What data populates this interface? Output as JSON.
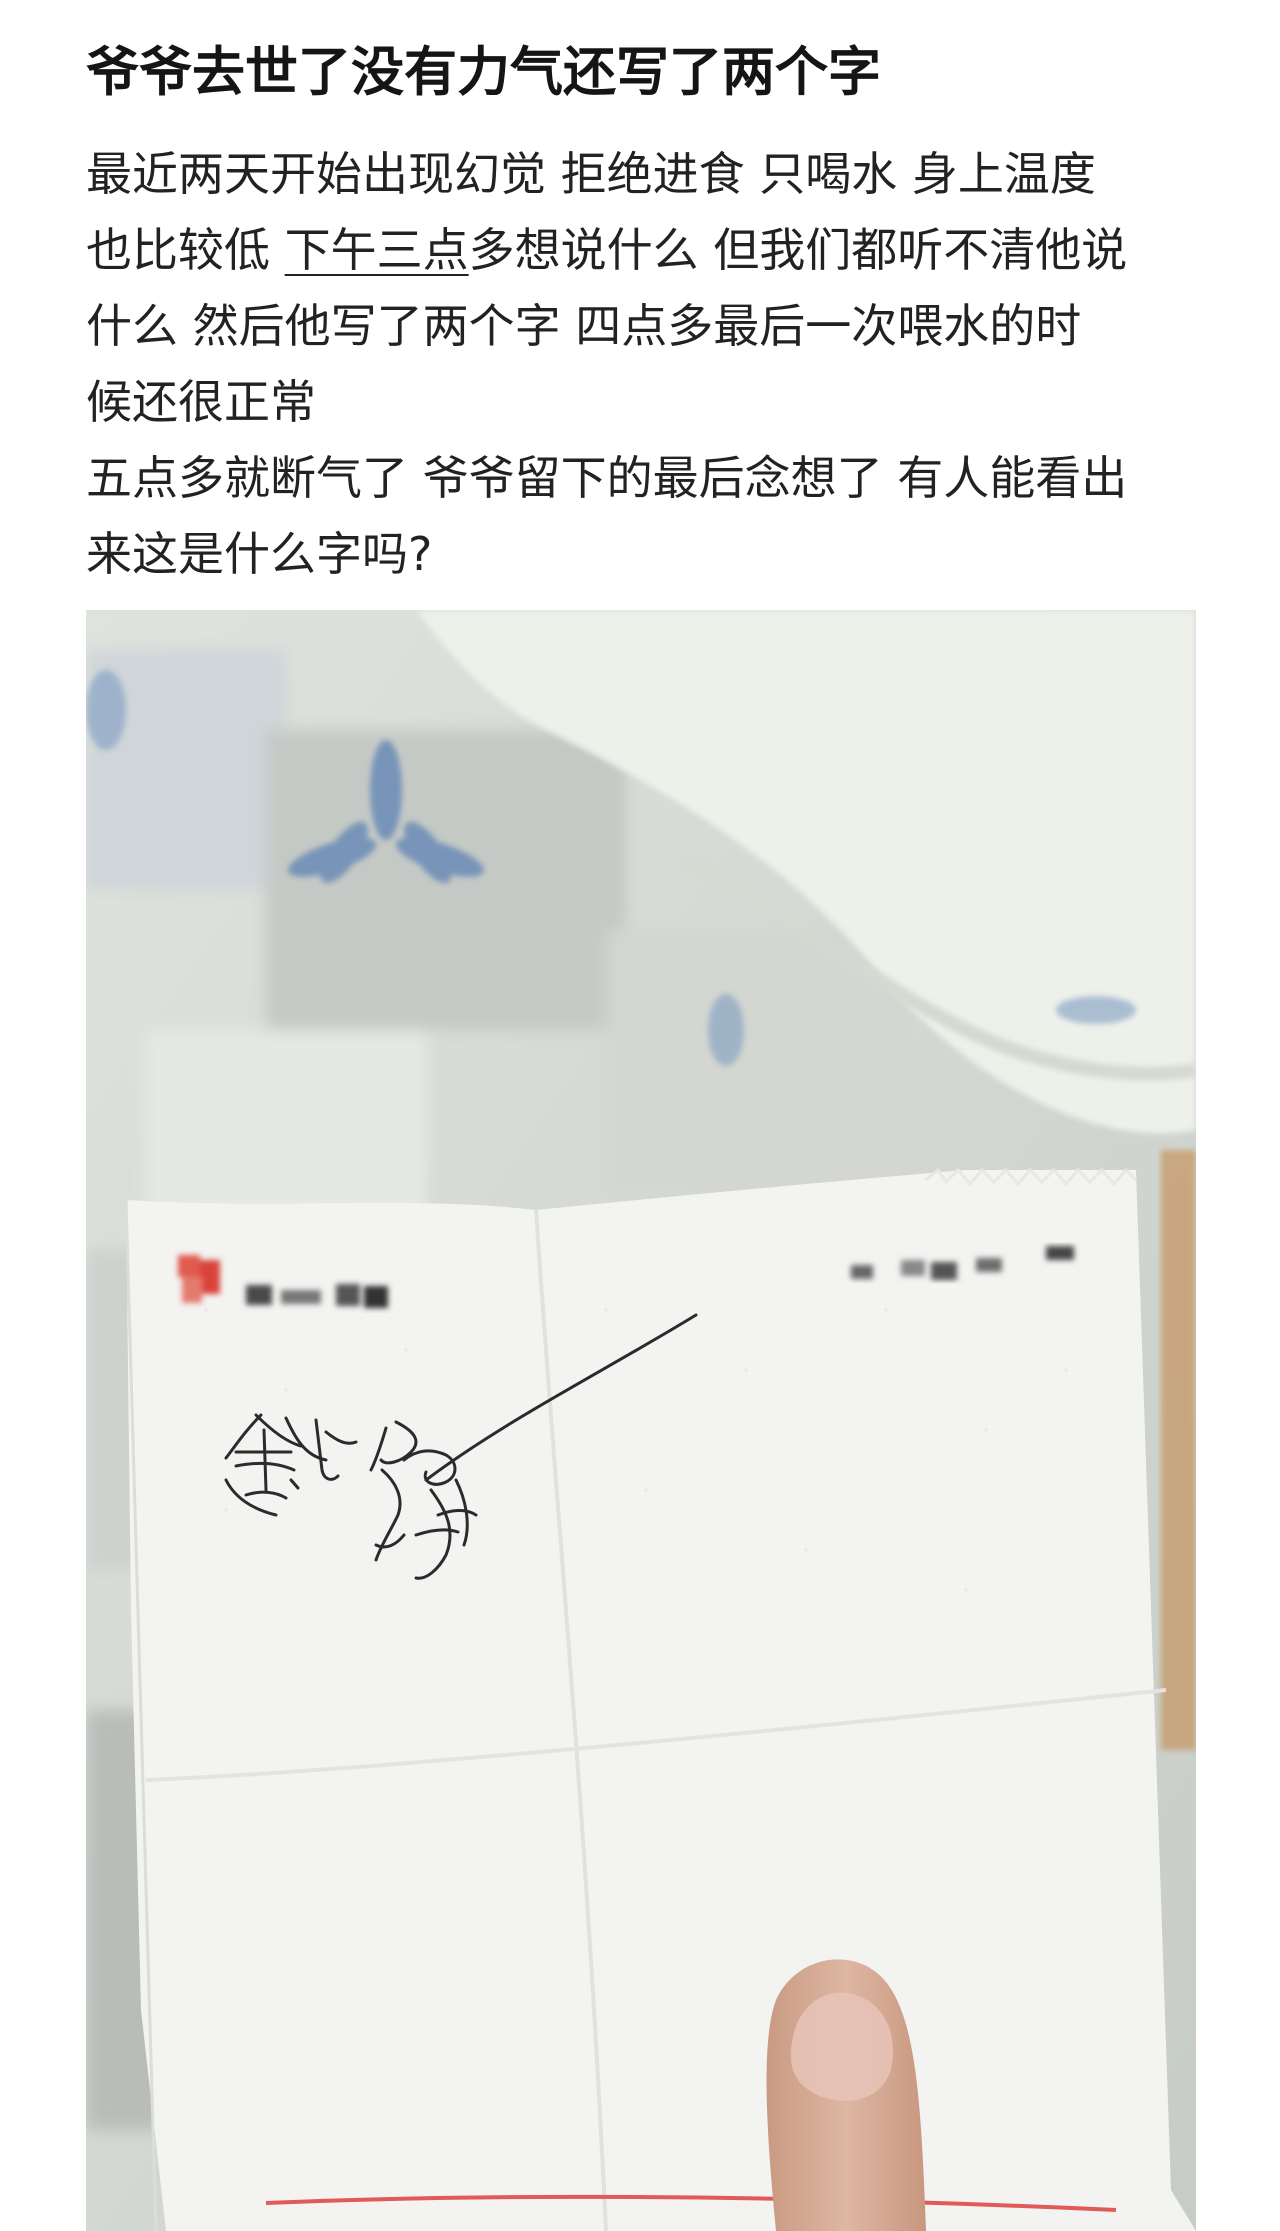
{
  "post": {
    "title": "爷爷去世了没有力气还写了两个字",
    "body": {
      "line1": "最近两天开始出现幻觉 拒绝进食 只喝水 身上温度",
      "line2_pre": "也比较低 ",
      "line2_underlined": "下午三点",
      "line2_post": "多想说什么 但我们都听不清他说",
      "line3": "什么 然后他写了两个字 四点多最后一次喂水的时",
      "line4": "候还很正常",
      "line5": "五点多就断气了 爷爷留下的最后念想了 有人能看出",
      "line6": "来这是什么字吗?"
    },
    "photo": {
      "alt": "",
      "colors": {
        "blanket_light": "#dfe3dd",
        "blanket_gray": "#c9cdc8",
        "flower_blue": "#6f8fb8",
        "pillow": "#eef0ea",
        "paper": "#f3f3f1",
        "ink": "#2b2b2b",
        "blur_red": "#d9433a",
        "skin": "#d9b39d",
        "nail": "#e8c3b8"
      }
    }
  }
}
